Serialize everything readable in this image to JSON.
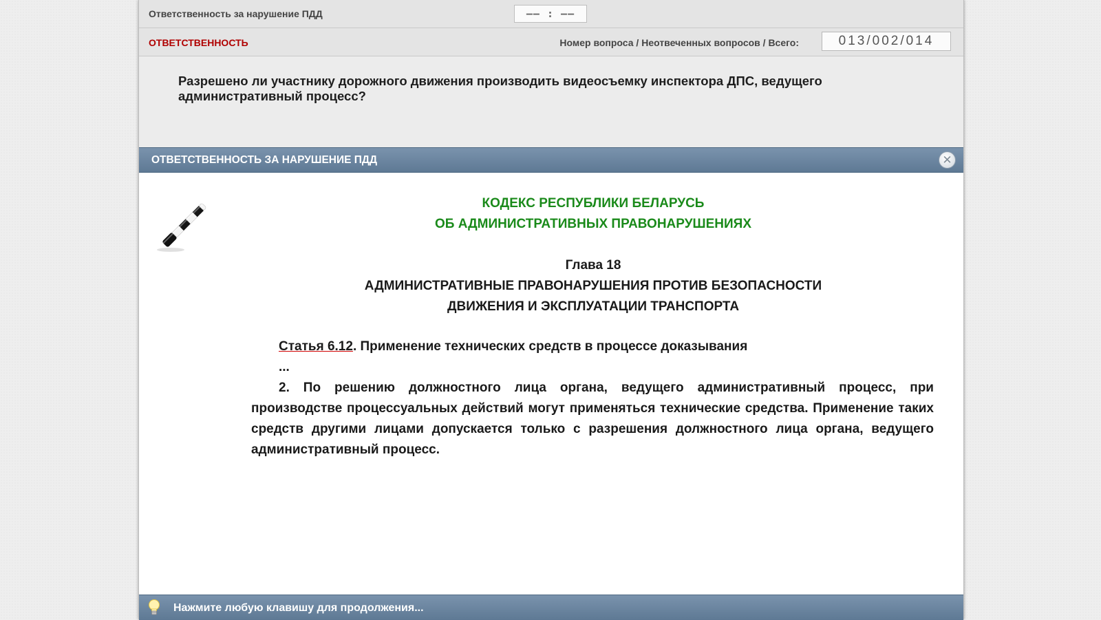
{
  "topbar": {
    "title": "Ответственность за нарушение ПДД",
    "timer": "—— : ——"
  },
  "infobar": {
    "category": "ОТВЕТСТВЕННОСТЬ",
    "counter_label": "Номер вопроса / Неотвеченных вопросов / Всего:",
    "counter_value": "013/002/014"
  },
  "question": {
    "line1": "Разрешено ли участнику дорожного движения производить видеосъемку инспектора ДПС, ведущего",
    "line2": "административный процесс?"
  },
  "panel": {
    "title": "ОТВЕТСТВЕННОСТЬ ЗА НАРУШЕНИЕ ПДД",
    "close_symbol": "✕",
    "code_title_line1": "КОДЕКС РЕСПУБЛИКИ БЕЛАРУСЬ",
    "code_title_line2": "ОБ АДМИНИСТРАТИВНЫХ ПРАВОНАРУШЕНИЯХ",
    "chapter_number": "Глава 18",
    "chapter_title_line1": "АДМИНИСТРАТИВНЫЕ ПРАВОНАРУШЕНИЯ ПРОТИВ БЕЗОПАСНОСТИ",
    "chapter_title_line2": "ДВИЖЕНИЯ И ЭКСПЛУАТАЦИИ ТРАНСПОРТА",
    "article_link": "Статья 6.12",
    "article_title": ". Применение технических средств в процессе доказывания",
    "ellipsis": "...",
    "paragraph": "2. По решению должностного лица органа, ведущего административный процесс, при производстве процессуальных действий могут применяться технические средства. Применение таких средств другими лицами допускается только с разрешения должностного лица органа, ведущего административный процесс.",
    "accent_color": "#1a8a1a"
  },
  "footer": {
    "hint": "Нажмите любую клавишу для продолжения...",
    "icon": "lightbulb-icon"
  }
}
